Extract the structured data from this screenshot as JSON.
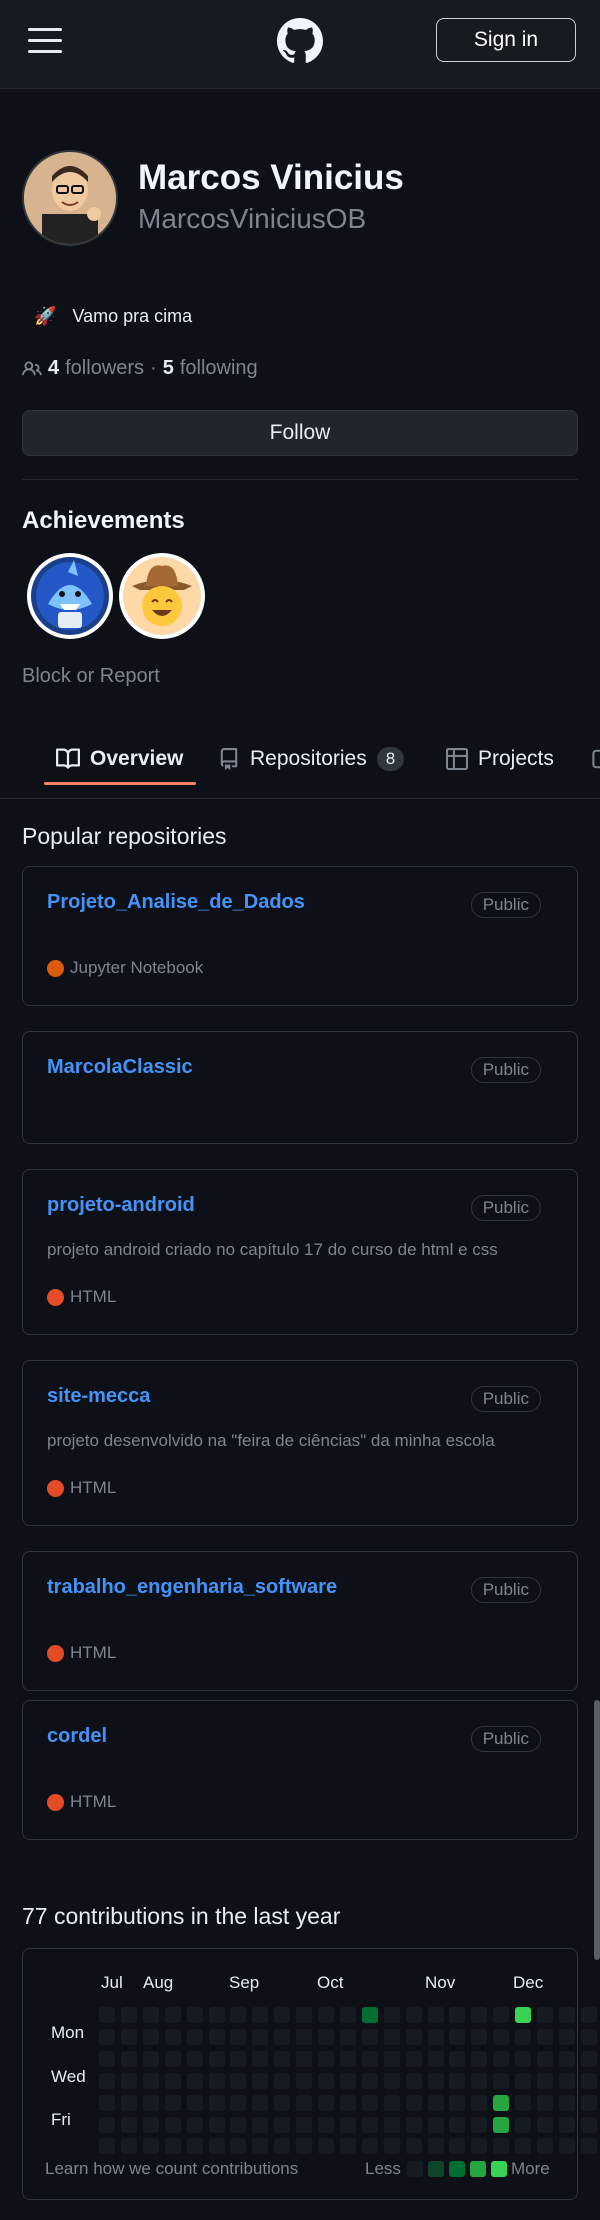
{
  "header": {
    "sign_in": "Sign in"
  },
  "profile": {
    "name": "Marcos Vinicius",
    "login": "MarcosViniciusOB",
    "status_emoji": "🚀",
    "status_text": "Vamo pra cima",
    "followers_count": "4",
    "followers_label": "followers",
    "separator": "·",
    "following_count": "5",
    "following_label": "following",
    "follow_button": "Follow",
    "achievements_title": "Achievements",
    "block_report": "Block or Report"
  },
  "tabs": [
    {
      "label": "Overview"
    },
    {
      "label": "Repositories",
      "count": "8"
    },
    {
      "label": "Projects"
    }
  ],
  "popular": {
    "title": "Popular repositories",
    "repos": [
      {
        "name": "Projeto_Analise_de_Dados",
        "visibility": "Public",
        "description": "",
        "language": "Jupyter Notebook",
        "language_color": "#DA5B0B"
      },
      {
        "name": "MarcolaClassic",
        "visibility": "Public",
        "description": "",
        "language": "",
        "language_color": ""
      },
      {
        "name": "projeto-android",
        "visibility": "Public",
        "description": "projeto android criado no capítulo 17 do curso de html e css",
        "language": "HTML",
        "language_color": "#e34c26"
      },
      {
        "name": "site-mecca",
        "visibility": "Public",
        "description": "projeto desenvolvido na \"feira de ciências\" da minha escola",
        "language": "HTML",
        "language_color": "#e34c26"
      },
      {
        "name": "trabalho_engenharia_software",
        "visibility": "Public",
        "description": "",
        "language": "HTML",
        "language_color": "#e34c26"
      },
      {
        "name": "cordel",
        "visibility": "Public",
        "description": "",
        "language": "HTML",
        "language_color": "#e34c26"
      }
    ]
  },
  "contributions": {
    "title": "77 contributions in the last year",
    "months": [
      "Jul",
      "Aug",
      "Sep",
      "Oct",
      "Nov",
      "Dec"
    ],
    "days": [
      "Mon",
      "Wed",
      "Fri"
    ],
    "learn_link": "Learn how we count contributions",
    "less": "Less",
    "more": "More",
    "colors": {
      "empty": "#161b22",
      "l1": "#0e4429",
      "l2": "#006d32",
      "l3": "#26a641",
      "l4": "#39d353"
    }
  }
}
